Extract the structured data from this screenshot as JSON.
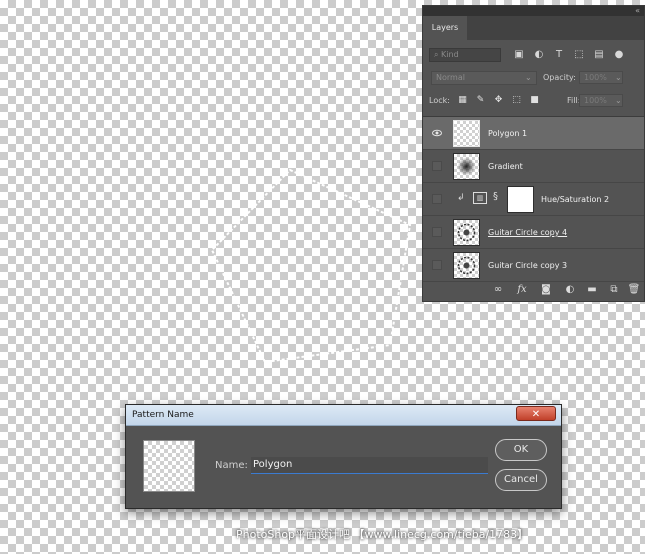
{
  "layers_panel": {
    "tab_label": "Layers",
    "kind_placeholder": "Kind",
    "blend_mode": "Normal",
    "opacity_label": "Opacity:",
    "opacity_value": "100%",
    "lock_label": "Lock:",
    "fill_label": "Fill:",
    "fill_value": "100%",
    "layers": [
      {
        "name": "Polygon 1",
        "visible": true,
        "selected": true
      },
      {
        "name": "Gradient",
        "visible": false,
        "selected": false
      },
      {
        "name": "Hue/Saturation 2",
        "visible": false,
        "selected": false
      },
      {
        "name": "Guitar Circle copy 4",
        "visible": false,
        "selected": false
      },
      {
        "name": "Guitar Circle copy 3",
        "visible": false,
        "selected": false
      }
    ],
    "bottom_fx_label": "fx"
  },
  "dialog": {
    "title": "Pattern Name",
    "close_glyph": "✕",
    "name_label": "Name:",
    "name_value": "Polygon",
    "ok_label": "OK",
    "cancel_label": "Cancel"
  },
  "watermark": "PhotoShop平面设计吧 【www.linecg.com/tieba/1783】"
}
